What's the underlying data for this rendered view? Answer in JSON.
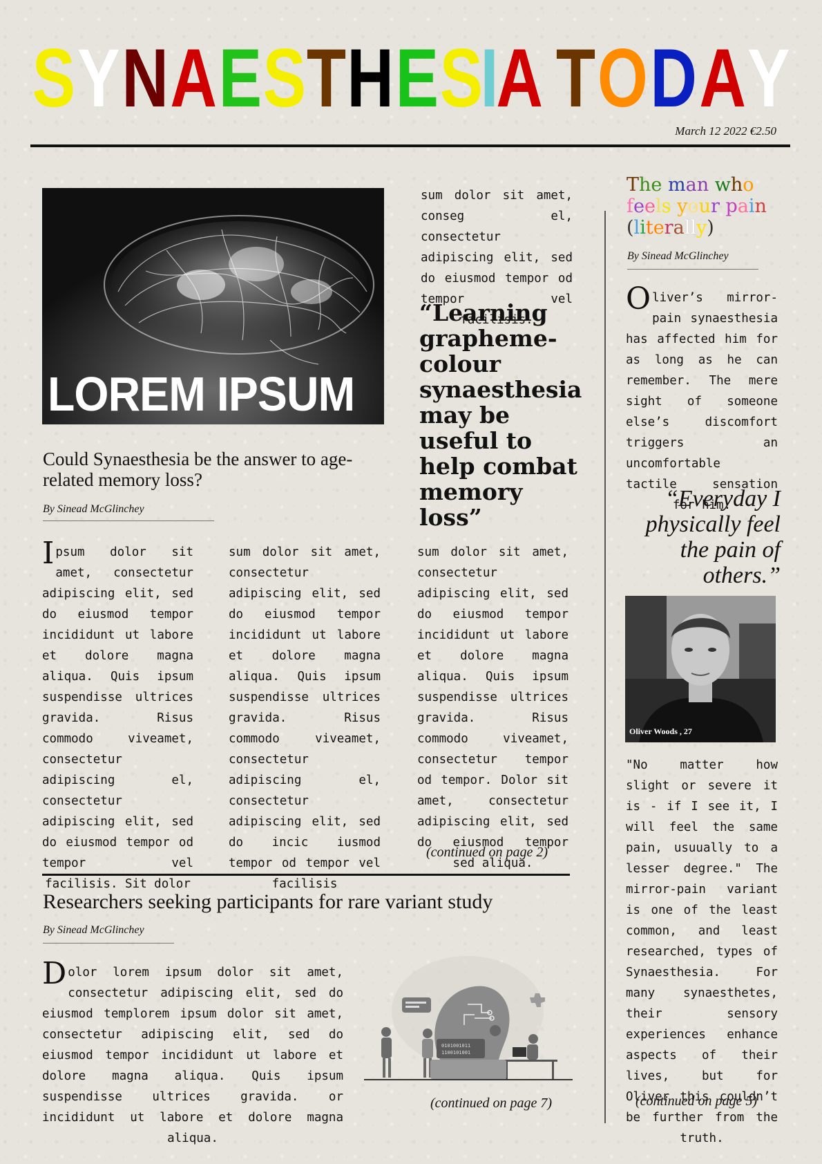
{
  "masthead": {
    "letters": [
      {
        "ch": "S",
        "color": "#f4ef00"
      },
      {
        "ch": "Y",
        "color": "#ffffff"
      },
      {
        "ch": "N",
        "color": "#6b0000"
      },
      {
        "ch": "A",
        "color": "#d10000"
      },
      {
        "ch": "E",
        "color": "#22c21a"
      },
      {
        "ch": "S",
        "color": "#f4ef00"
      },
      {
        "ch": "T",
        "color": "#6b3500"
      },
      {
        "ch": "H",
        "color": "#000000"
      },
      {
        "ch": "E",
        "color": "#18c218"
      },
      {
        "ch": "S",
        "color": "#f4ef00"
      },
      {
        "ch": "I",
        "color": "#6ecdd0"
      },
      {
        "ch": "A",
        "color": "#d10000"
      },
      {
        "ch": " ",
        "color": "#000000"
      },
      {
        "ch": "T",
        "color": "#6b3500"
      },
      {
        "ch": "O",
        "color": "#ff8c00"
      },
      {
        "ch": "D",
        "color": "#0a1fbf"
      },
      {
        "ch": "A",
        "color": "#d10000"
      },
      {
        "ch": "Y",
        "color": "#ffffff"
      }
    ]
  },
  "dateline": "March 12 2022 €2.50",
  "lead": {
    "image_overlay": "LOREM IPSUM",
    "headline": "Could Synaesthesia be the answer to age-related memory loss?",
    "byline": "By Sinead McGlinchey",
    "col1": "Ipsum dolor sit amet, consectetur adipiscing elit, sed do eiusmod tempor incididunt ut labore et dolore magna aliqua. Quis ipsum suspendisse ultrices gravida. Risus commodo viveamet, consectetur adipiscing el, consectetur adipiscing elit, sed do eiusmod tempor od tempor vel facilisis. Sit dolor",
    "col2": "sum dolor sit amet, consectetur adipiscing elit, sed do eiusmod tempor incididunt ut labore et dolore magna aliqua. Quis ipsum suspendisse ultrices gravida. Risus commodo viveamet, consectetur adipiscing el, consectetur adipiscing elit, sed do incic iusmod tempor od tempor vel facilisis",
    "col3_top": "sum dolor sit amet, conseg el, consectetur adipiscing elit, sed do eiusmod tempor od tempor vel facilisis.",
    "pullquote": "“Learning grapheme-colour synaesthesia may be useful to help combat memory loss”",
    "col3_bottom": "sum dolor sit amet, consectetur adipiscing elit, sed do eiusmod tempor incididunt ut labore et dolore magna aliqua. Quis ipsum suspendisse ultrices gravida. Risus commodo viveamet, consectetur tempor od tempor. Dolor sit amet, consectetur adipiscing elit, sed do eiusmod tempor sed aliqua.",
    "continued": "(continued on page 2)"
  },
  "second": {
    "headline": "Researchers seeking participants for rare variant study",
    "byline": "By Sinead McGlinchey",
    "body": "Dolor lorem ipsum dolor sit amet, consectetur adipiscing elit, sed do eiusmod templorem ipsum dolor sit amet, consectetur adipiscing elit, sed do eiusmod tempor incididunt ut labore et dolore magna aliqua. Quis ipsum suspendisse ultrices gravida. or incididunt ut labore et dolore magna aliqua.",
    "continued": "(continued on page 7)"
  },
  "sidebar": {
    "headline_segments": [
      {
        "t": "T",
        "c": "#6b3500"
      },
      {
        "t": "h",
        "c": "#3c8c1a"
      },
      {
        "t": "e",
        "c": "#3c8c1a"
      },
      {
        "t": " ",
        "c": "#000"
      },
      {
        "t": "m",
        "c": "#2a3fa8"
      },
      {
        "t": "a",
        "c": "#8a3fa8"
      },
      {
        "t": "n",
        "c": "#8a3fa8"
      },
      {
        "t": " ",
        "c": "#000"
      },
      {
        "t": "w",
        "c": "#1a7a1a"
      },
      {
        "t": "h",
        "c": "#6b3500"
      },
      {
        "t": "o",
        "c": "#ff9a00"
      },
      {
        "t": " ",
        "c": "#000"
      },
      {
        "t": "f",
        "c": "#ff6fb0"
      },
      {
        "t": "e",
        "c": "#9a3fd0"
      },
      {
        "t": "e",
        "c": "#ff5a9a"
      },
      {
        "t": "l",
        "c": "#f0e060"
      },
      {
        "t": "s",
        "c": "#f7e400"
      },
      {
        "t": " ",
        "c": "#000"
      },
      {
        "t": "y",
        "c": "#ffb000"
      },
      {
        "t": "o",
        "c": "#ffe070"
      },
      {
        "t": "u",
        "c": "#ffd000"
      },
      {
        "t": "r",
        "c": "#9a3fd0"
      },
      {
        "t": " ",
        "c": "#000"
      },
      {
        "t": "p",
        "c": "#c040c0"
      },
      {
        "t": "a",
        "c": "#ff6fa0"
      },
      {
        "t": "i",
        "c": "#4aa0e0"
      },
      {
        "t": "n",
        "c": "#d04040"
      },
      {
        "t": " ",
        "c": "#000"
      },
      {
        "t": "(",
        "c": "#333333"
      },
      {
        "t": "l",
        "c": "#40a0e0"
      },
      {
        "t": "i",
        "c": "#20a040"
      },
      {
        "t": "t",
        "c": "#ff7a00"
      },
      {
        "t": "e",
        "c": "#ff8a00"
      },
      {
        "t": "r",
        "c": "#c03060"
      },
      {
        "t": "a",
        "c": "#a05030"
      },
      {
        "t": "l",
        "c": "#ffffff"
      },
      {
        "t": "l",
        "c": "#ffffff"
      },
      {
        "t": "y",
        "c": "#ffe000"
      },
      {
        "t": ")",
        "c": "#333333"
      }
    ],
    "byline": "By Sinead McGlinchey",
    "intro": "Oliver’s mirror-pain synaesthesia has affected him for as long as he can remember. The mere sight of someone else’s discomfort triggers an uncomfortable tactile sensation for him.",
    "quote": "“Everyday I physically feel the pain of others.”",
    "photo_caption": "Oliver Woods , 27",
    "body": "\"No matter how slight or severe it is - if I see it, I will feel the same pain, usuually to a lesser degree.\" The mirror-pain variant is one of the least common, and least researched, types of Synaesthesia. For many synaesthetes, their sensory experiences enhance aspects of their lives, but for Oliver this couldn’t be further from the truth.",
    "continued": "(continued on page 5)"
  }
}
